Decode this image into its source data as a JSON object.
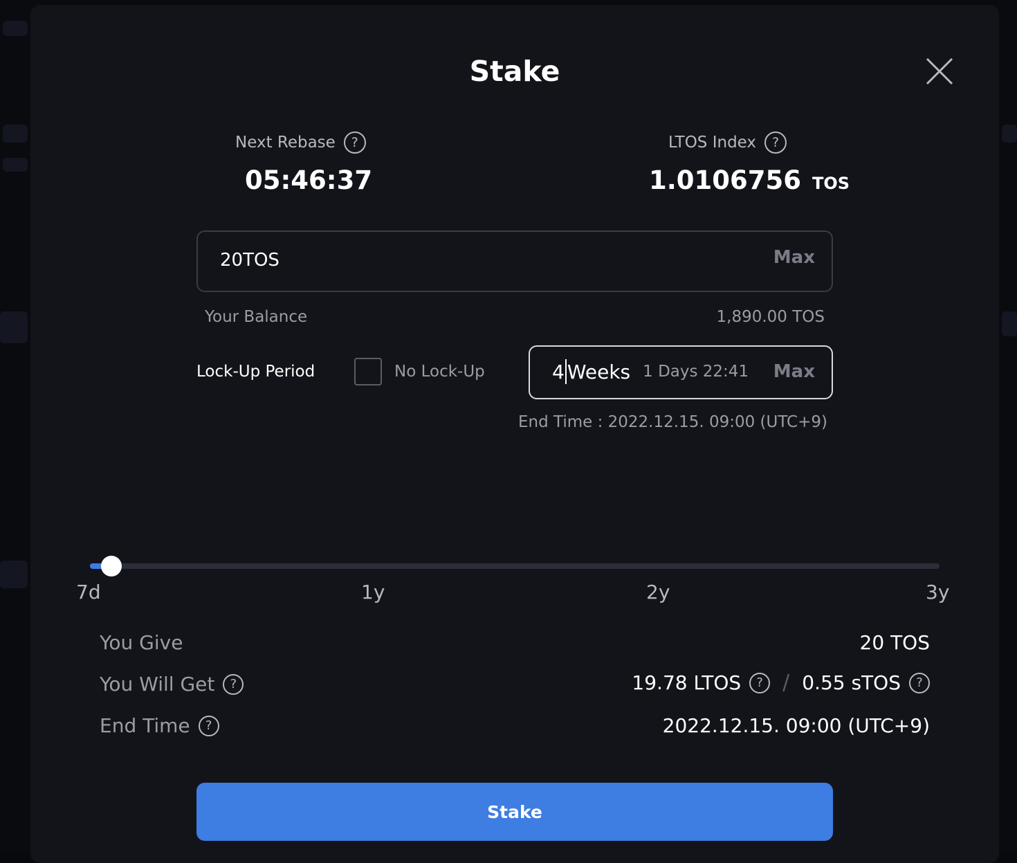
{
  "modal": {
    "title": "Stake"
  },
  "stats": {
    "next_rebase_label": "Next Rebase",
    "next_rebase_value": "05:46:37",
    "ltos_index_label": "LTOS Index",
    "ltos_index_value": "1.0106756",
    "ltos_index_unit": "TOS"
  },
  "amount": {
    "value": "20TOS",
    "max_label": "Max",
    "balance_label": "Your Balance",
    "balance_value": "1,890.00 TOS"
  },
  "lockup": {
    "label": "Lock-Up Period",
    "no_lockup_label": "No Lock-Up",
    "no_lockup_checked": false,
    "weeks_value": "4",
    "weeks_unit": "Weeks",
    "weeks_remaining": "1 Days 22:41",
    "max_label": "Max",
    "end_time_hint": "End Time : 2022.12.15. 09:00 (UTC+9)"
  },
  "slider": {
    "level_fraction": 0.025,
    "ticks": [
      "7d",
      "1y",
      "2y",
      "3y"
    ]
  },
  "summary": {
    "give_label": "You Give",
    "give_value": "20 TOS",
    "get_label": "You Will Get",
    "get_ltos": "19.78 LTOS",
    "get_separator": "/",
    "get_stos": "0.55 sTOS",
    "end_label": "End Time",
    "end_value": "2022.12.15. 09:00 (UTC+9)"
  },
  "actions": {
    "stake_label": "Stake"
  },
  "colors": {
    "accent": "#3e7de2",
    "modal_bg": "#13141a",
    "text_muted": "#9a9da6"
  }
}
